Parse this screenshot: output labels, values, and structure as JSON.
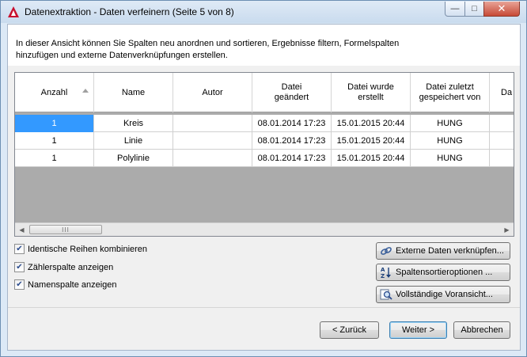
{
  "window": {
    "title": "Datenextraktion - Daten verfeinern (Seite 5 von 8)",
    "minimize_glyph": "—",
    "maximize_glyph": "□",
    "close_glyph": "✕"
  },
  "intro": {
    "line1": "In dieser Ansicht können Sie Spalten neu anordnen und sortieren, Ergebnisse filtern, Formelspalten",
    "line2": "hinzufügen und externe Datenverknüpfungen erstellen."
  },
  "grid": {
    "columns": [
      {
        "label": "Anzahl"
      },
      {
        "label": "Name"
      },
      {
        "label": "Autor"
      },
      {
        "label": "Datei geändert"
      },
      {
        "label": "Datei wurde erstellt"
      },
      {
        "label": "Datei zuletzt gespeichert von"
      },
      {
        "label": "Da"
      }
    ],
    "rows": [
      {
        "anzahl": "1",
        "name": "Kreis",
        "autor": "",
        "geaendert": "08.01.2014 17:23",
        "erstellt": "15.01.2015 20:44",
        "gespeichert": "HUNG",
        "extra": ""
      },
      {
        "anzahl": "1",
        "name": "Linie",
        "autor": "",
        "geaendert": "08.01.2014 17:23",
        "erstellt": "15.01.2015 20:44",
        "gespeichert": "HUNG",
        "extra": ""
      },
      {
        "anzahl": "1",
        "name": "Polylinie",
        "autor": "",
        "geaendert": "08.01.2014 17:23",
        "erstellt": "15.01.2015 20:44",
        "gespeichert": "HUNG",
        "extra": ""
      }
    ],
    "scroll_thumb_glyph": "III"
  },
  "options": {
    "combine_rows": {
      "label": "Identische Reihen kombinieren",
      "checked": true
    },
    "show_count": {
      "label": "Zählerspalte anzeigen",
      "checked": true
    },
    "show_name": {
      "label": "Namenspalte anzeigen",
      "checked": true
    },
    "check_glyph": "✔"
  },
  "actions": {
    "link_external": "Externe Daten verknüpfen...",
    "sort_options": "Spaltensortieroptionen ...",
    "full_preview": "Vollständige Voransicht..."
  },
  "footer": {
    "back": "< Zurück",
    "next": "Weiter >",
    "cancel": "Abbrechen"
  },
  "colors": {
    "selection": "#3399ff",
    "grid_empty": "#ababab",
    "app_icon": "#c8102e"
  }
}
